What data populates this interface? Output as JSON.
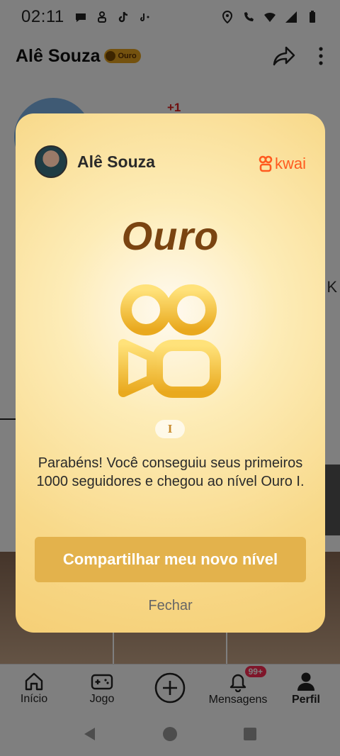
{
  "status_bar": {
    "time": "02:11"
  },
  "header": {
    "name": "Alê Souza",
    "badge": "Ouro"
  },
  "background": {
    "plus_count": "+1",
    "letter": "K"
  },
  "modal": {
    "user_name": "Alê Souza",
    "brand": "kwai",
    "level_title": "Ouro",
    "level_roman": "I",
    "message": "Parabéns! Você conseguiu seus primeiros 1000 seguidores e chegou ao nível Ouro I.",
    "share_label": "Compartilhar meu novo nível",
    "close_label": "Fechar",
    "colors": {
      "accent": "#e3b24c",
      "title": "#7a4411",
      "brand": "#ff5a1f"
    }
  },
  "bottom_nav": {
    "items": [
      {
        "label": "Início",
        "icon": "home-icon"
      },
      {
        "label": "Jogo",
        "icon": "gamepad-icon"
      },
      {
        "label": "",
        "icon": "plus-circle-icon"
      },
      {
        "label": "Mensagens",
        "icon": "bell-icon",
        "badge": "99+"
      },
      {
        "label": "Perfil",
        "icon": "person-icon"
      }
    ]
  }
}
